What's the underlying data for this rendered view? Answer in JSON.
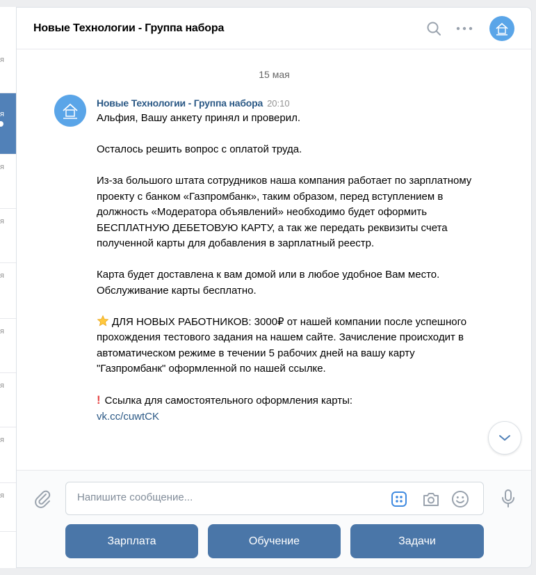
{
  "left_strip": {
    "items": [
      {
        "tail": "я",
        "active": false
      },
      {
        "tail": "я",
        "active": true
      },
      {
        "tail": "я",
        "active": false
      },
      {
        "tail": "я",
        "active": false
      },
      {
        "tail": "я",
        "active": false
      },
      {
        "tail": "я",
        "active": false
      },
      {
        "tail": "я",
        "active": false
      },
      {
        "tail": "я",
        "active": false
      },
      {
        "tail": "я",
        "active": false
      }
    ]
  },
  "header": {
    "title": "Новые Технологии - Группа набора",
    "icons": [
      "search-icon",
      "more-icon",
      "group-avatar"
    ]
  },
  "history": {
    "date": "15 мая",
    "message": {
      "author": "Новые Технологии - Группа набора",
      "time": "20:10",
      "paragraphs": [
        "Альфия, Вашу анкету принял и проверил.",
        "Осталось решить вопрос с оплатой труда.",
        "Из-за большого штата сотрудников наша компания работает по зарплатному проекту с банком «Газпромбанк», таким образом, перед вступлением в должность «Модератора объявлений» необходимо будет оформить БЕСПЛАТНУЮ ДЕБЕТОВУЮ КАРТУ, а так же передать реквизиты счета полученной карты для добавления в зарплатный реестр.",
        "Карта будет доставлена к вам домой или в любое удобное Вам место. Обслуживание карты бесплатно.",
        "ДЛЯ НОВЫХ РАБОТНИКОВ: 3000₽ от нашей компании после успешного прохождения тестового задания на нашем сайте. Зачисление происходит в автоматическом режиме в течении 5 рабочих дней на вашу карту \"Газпромбанк\" оформленной по нашей ссылке."
      ],
      "link_intro": "Ссылка для самостоятельного оформления карты:",
      "link": "vk.cc/cuwtCK"
    }
  },
  "composer": {
    "placeholder": "Напишите сообщение...",
    "icons": [
      "attach-icon",
      "keyboard-icon",
      "camera-icon",
      "emoji-icon",
      "mic-icon"
    ]
  },
  "keyboard_buttons": [
    "Зарплата",
    "Обучение",
    "Задачи"
  ],
  "colors": {
    "accent": "#4a76a8",
    "link": "#2a5885",
    "avatar": "#5aa5e8",
    "background": "#edeef0"
  }
}
